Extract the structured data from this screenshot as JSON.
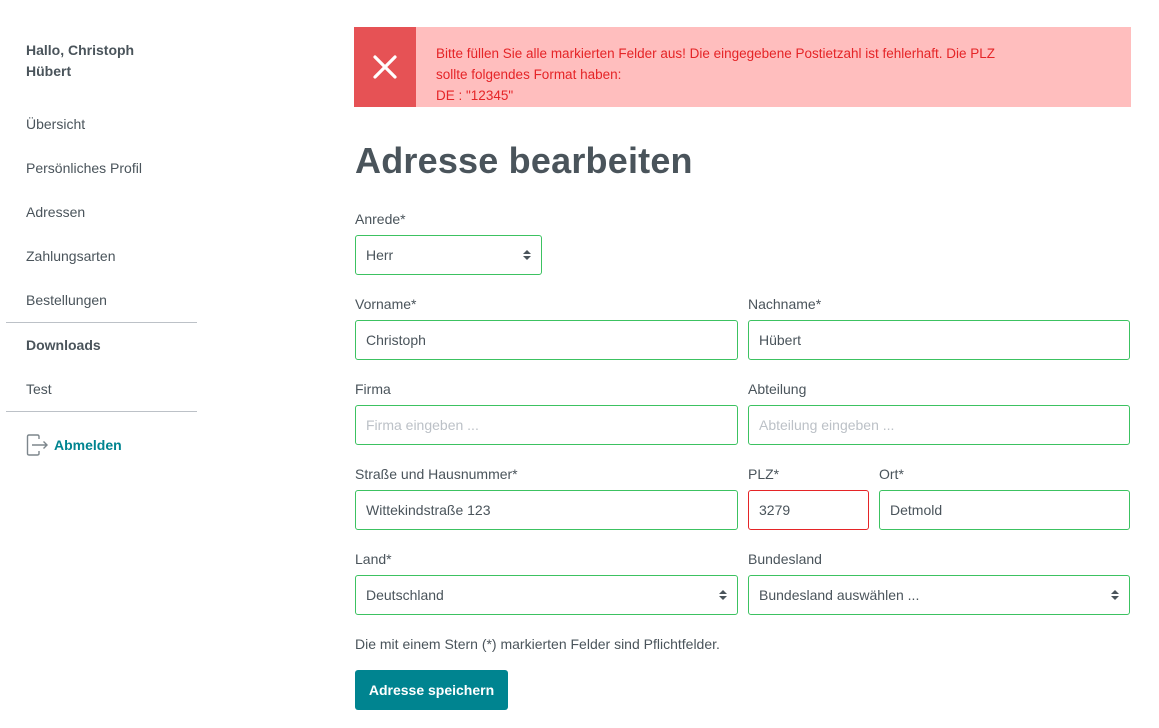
{
  "sidebar": {
    "greeting": "Hallo, Christoph Hübert",
    "items": [
      {
        "label": "Übersicht"
      },
      {
        "label": "Persönliches Profil"
      },
      {
        "label": "Adressen"
      },
      {
        "label": "Zahlungsarten"
      },
      {
        "label": "Bestellungen"
      }
    ],
    "section2": [
      {
        "label": "Downloads"
      },
      {
        "label": "Test"
      }
    ],
    "logout_label": "Abmelden"
  },
  "alert": {
    "icon": "close-icon",
    "line1": "Bitte füllen Sie alle markierten Felder aus! Die eingegebene Postietzahl ist fehlerhaft. Die PLZ",
    "line2": "sollte folgendes Format haben:",
    "line3": "DE : \"12345\"",
    "colors": {
      "background": "#ffbebe",
      "icon_background": "#e65255",
      "text": "#e52427"
    }
  },
  "form": {
    "title": "Adresse bearbeiten",
    "salutation": {
      "label": "Anrede*",
      "value": "Herr"
    },
    "first_name": {
      "label": "Vorname*",
      "value": "Christoph"
    },
    "last_name": {
      "label": "Nachname*",
      "value": "Hübert"
    },
    "company": {
      "label": "Firma",
      "value": "",
      "placeholder": "Firma eingeben ..."
    },
    "department": {
      "label": "Abteilung",
      "value": "",
      "placeholder": "Abteilung eingeben ..."
    },
    "street": {
      "label": "Straße und Hausnummer*",
      "value": "Wittekindstraße 123"
    },
    "zipcode": {
      "label": "PLZ*",
      "value": "3279",
      "state": "error"
    },
    "city": {
      "label": "Ort*",
      "value": "Detmold"
    },
    "country": {
      "label": "Land*",
      "value": "Deutschland"
    },
    "state": {
      "label": "Bundesland",
      "value": "Bundesland auswählen ..."
    },
    "required_hint": "Die mit einem Stern (*) markierten Felder sind Pflichtfelder.",
    "save_label": "Adresse speichern"
  },
  "colors": {
    "accent": "#008490",
    "valid_border": "#3cc261",
    "error_border": "#e52427",
    "text": "#4a545b"
  }
}
